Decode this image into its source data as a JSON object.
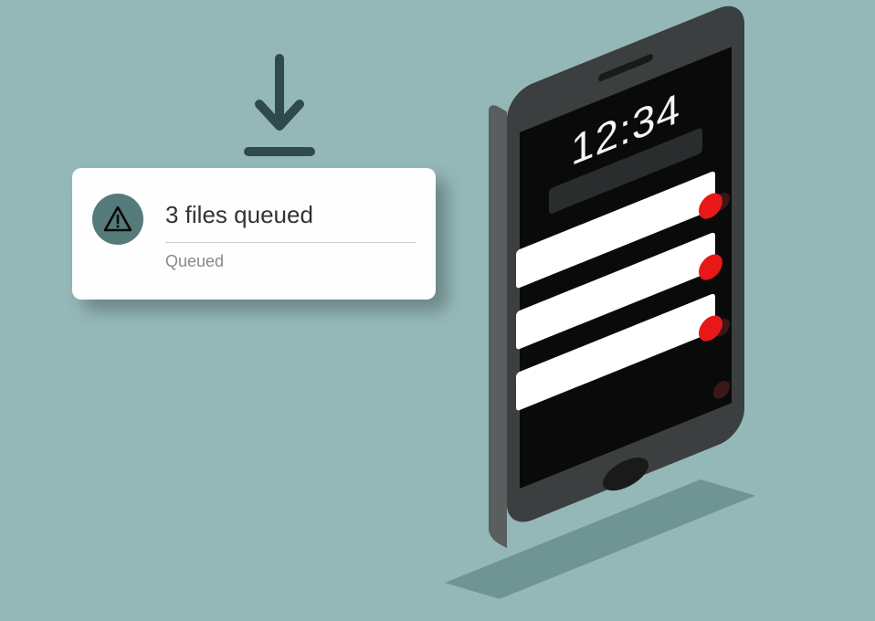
{
  "download": {
    "icon_name": "download-icon"
  },
  "notification": {
    "title": "3 files queued",
    "status": "Queued",
    "warning_icon": "warning-triangle-icon"
  },
  "phone": {
    "time": "12:34",
    "queued_count": 3
  },
  "colors": {
    "background": "#94b8b8",
    "card": "#fefefe",
    "phone_body": "#3b3f3f",
    "phone_side": "#5a5e5e",
    "screen": "#0a0a0a",
    "alert_dot": "#e81818",
    "icon_dark": "#2e4a4a"
  }
}
